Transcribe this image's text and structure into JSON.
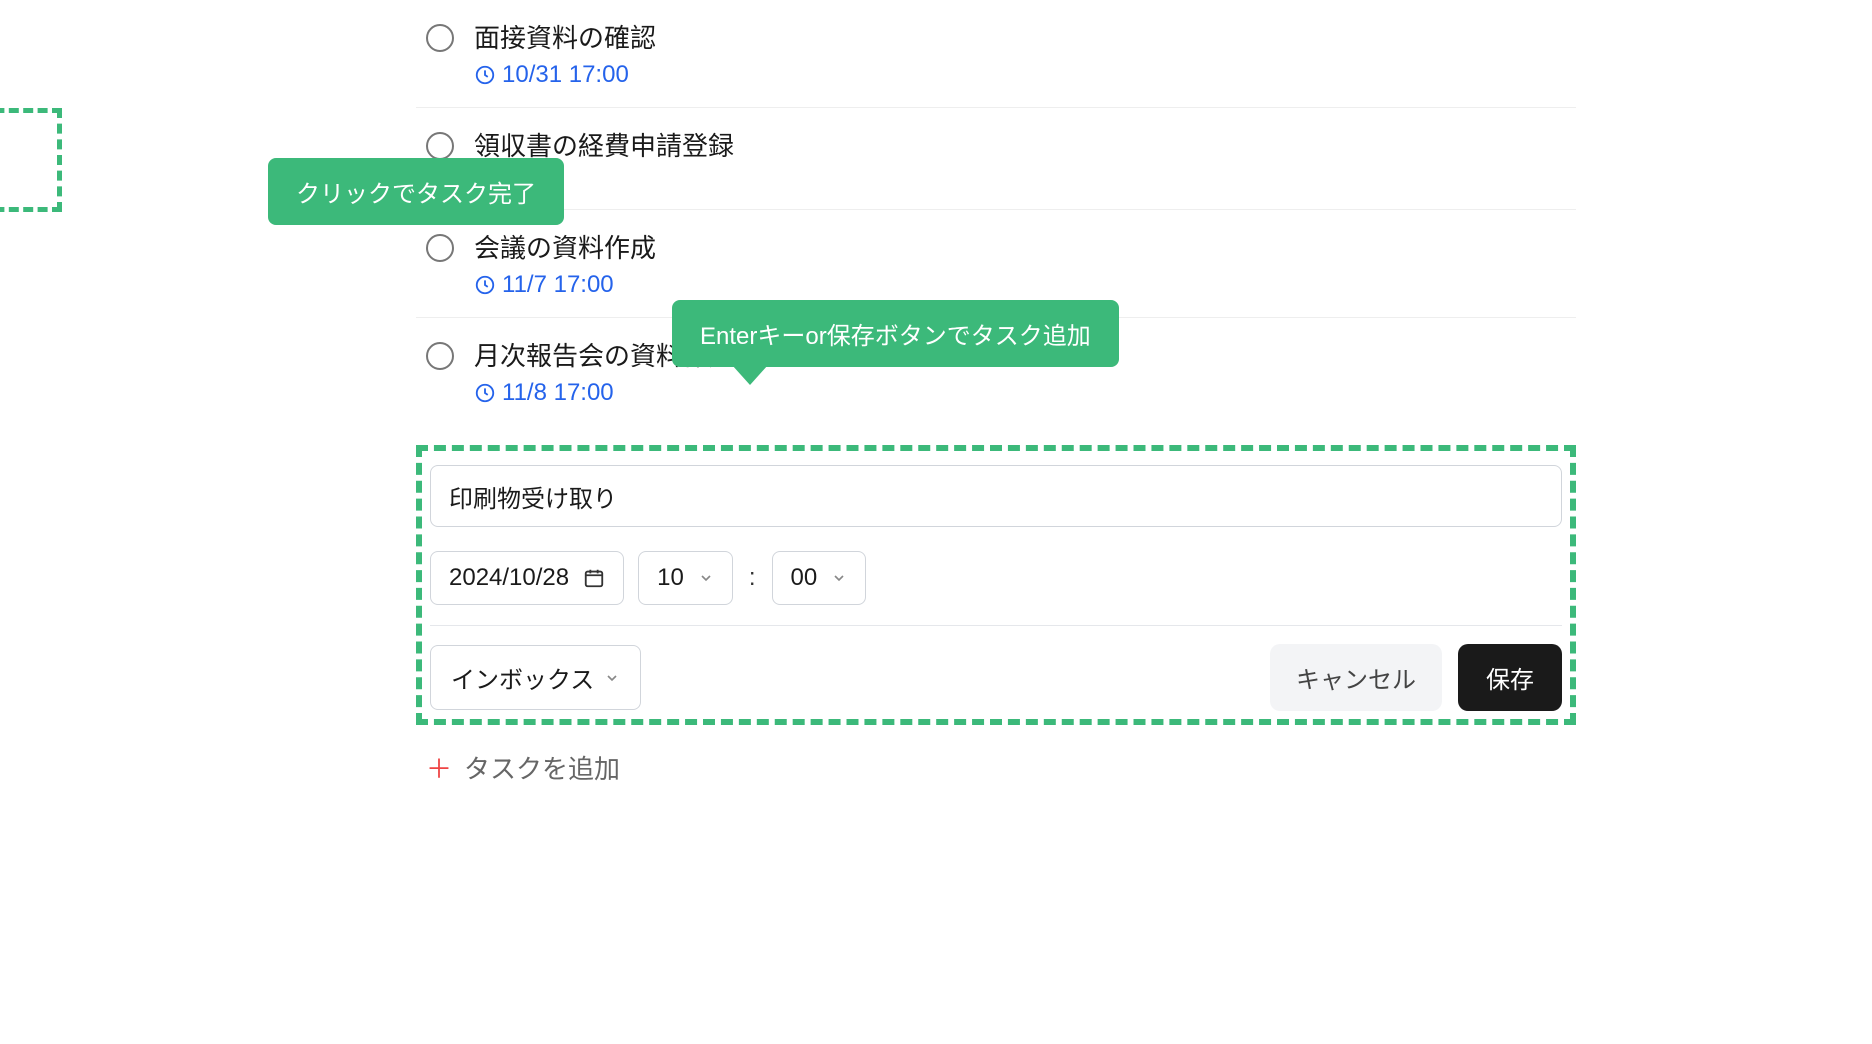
{
  "tasks": [
    {
      "title": "面接資料の確認",
      "due": "10/31 17:00"
    },
    {
      "title": "領収書の経費申請登録",
      "due": ""
    },
    {
      "title": "会議の資料作成",
      "due": "11/7 17:00"
    },
    {
      "title": "月次報告会の資料作成",
      "due": "11/8 17:00"
    }
  ],
  "tooltips": {
    "complete": "クリックでタスク完了",
    "add": "Enterキーor保存ボタンでタスク追加"
  },
  "form": {
    "task_title": "印刷物受け取り",
    "date": "2024/10/28",
    "hour": "10",
    "minute": "00",
    "category": "インボックス",
    "cancel_label": "キャンセル",
    "save_label": "保存"
  },
  "add_task_label": "タスクを追加"
}
